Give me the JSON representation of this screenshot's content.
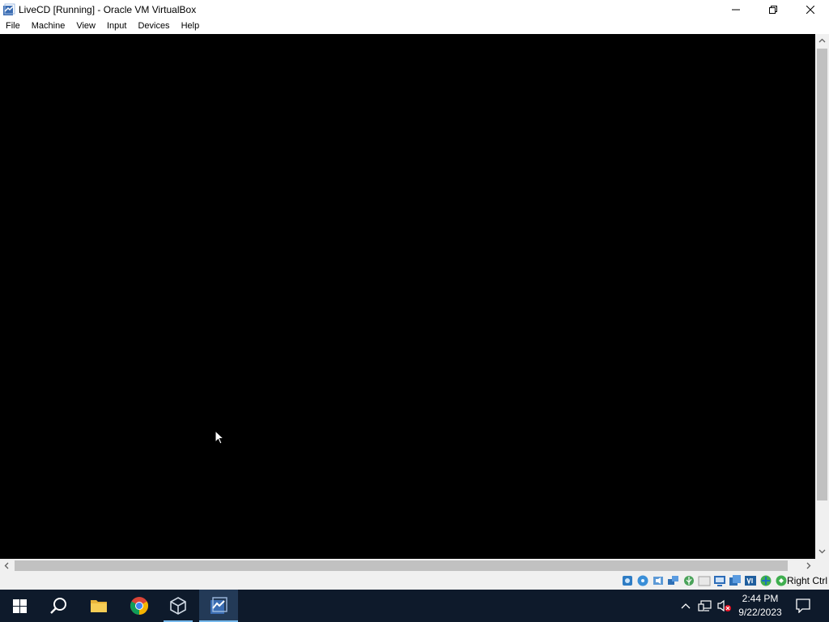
{
  "window": {
    "title": "LiveCD [Running] - Oracle VM VirtualBox",
    "icon": "virtualbox-icon",
    "controls": [
      "minimize-icon",
      "restore-icon",
      "close-icon"
    ]
  },
  "menu": {
    "items": [
      "File",
      "Machine",
      "View",
      "Input",
      "Devices",
      "Help"
    ]
  },
  "vm": {
    "screen_color": "#000000"
  },
  "statusbar": {
    "icons": [
      "hard-disk-icon",
      "optical-drive-icon",
      "audio-icon",
      "network-icon",
      "usb-icon",
      "shared-folders-icon",
      "display-icon",
      "recording-icon",
      "virtualization-icon",
      "mouse-integration-icon",
      "keyboard-capture-icon"
    ],
    "host_key": "Right Ctrl"
  },
  "taskbar": {
    "buttons": [
      "windows-start-icon",
      "search-icon",
      "file-explorer-icon",
      "chrome-icon",
      "virtualbox-manager-icon",
      "virtualbox-vm-icon"
    ],
    "tray": [
      "show-hidden-icons-chevron-icon",
      "network-icon",
      "volume-muted-icon"
    ],
    "clock": {
      "time": "2:44 PM",
      "date": "9/22/2023"
    },
    "notification": "action-center-icon"
  },
  "colors": {
    "taskbar_bg": "#0e1a2b",
    "active_indicator": "#76b9ed",
    "scrollbar_thumb": "#c1c1c1"
  }
}
